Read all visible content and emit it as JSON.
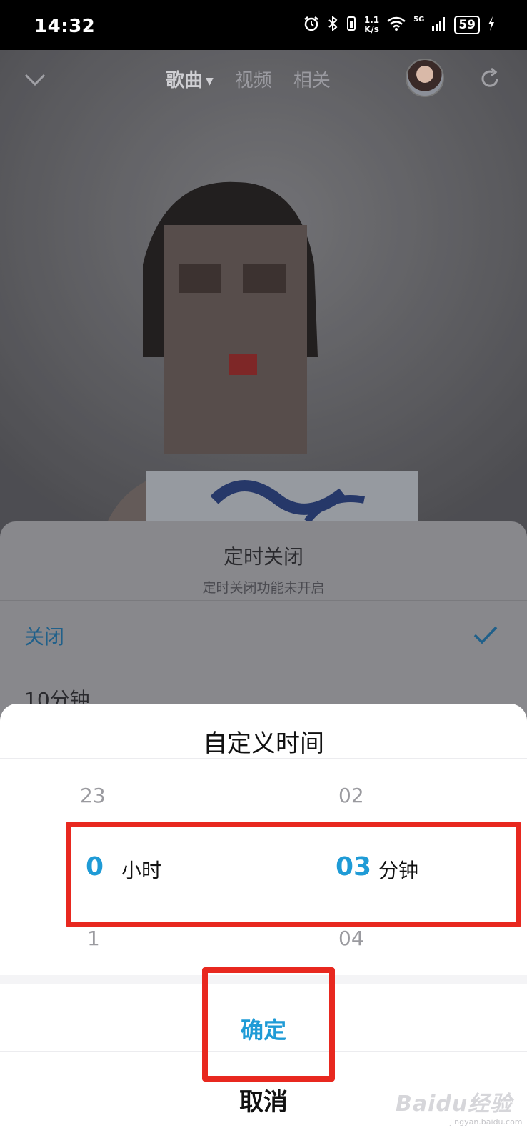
{
  "status_bar": {
    "time": "14:32",
    "speed_value": "1.1",
    "speed_unit": "K/s",
    "network": "5G",
    "battery": "59",
    "icons": [
      "alarm-icon",
      "bluetooth-icon",
      "vibrate-icon",
      "wifi-icon",
      "signal-icon",
      "battery-icon",
      "charging-icon"
    ]
  },
  "player": {
    "tabs": [
      {
        "label": "歌曲",
        "active": true
      },
      {
        "label": "视频",
        "active": false
      },
      {
        "label": "相关",
        "active": false
      }
    ],
    "icons": [
      "chevron-down-icon",
      "avatar",
      "share-icon"
    ]
  },
  "sleep_timer_sheet": {
    "title": "定时关闭",
    "subtitle": "定时关闭功能未开启",
    "selected_option": "关闭",
    "next_option_partial": "10分钟"
  },
  "custom_time_dialog": {
    "title": "自定义时间",
    "hour_above": "23",
    "hour_selected": "0",
    "hour_unit": "小时",
    "hour_below": "1",
    "minute_above": "02",
    "minute_selected": "03",
    "minute_unit": "分钟",
    "minute_below": "04",
    "confirm_label": "确定",
    "cancel_label": "取消"
  },
  "watermark": {
    "logo": "Baidu经验",
    "url": "jingyan.baidu.com"
  },
  "colors": {
    "accent": "#1f9bd6",
    "annotation": "#e8281f"
  }
}
